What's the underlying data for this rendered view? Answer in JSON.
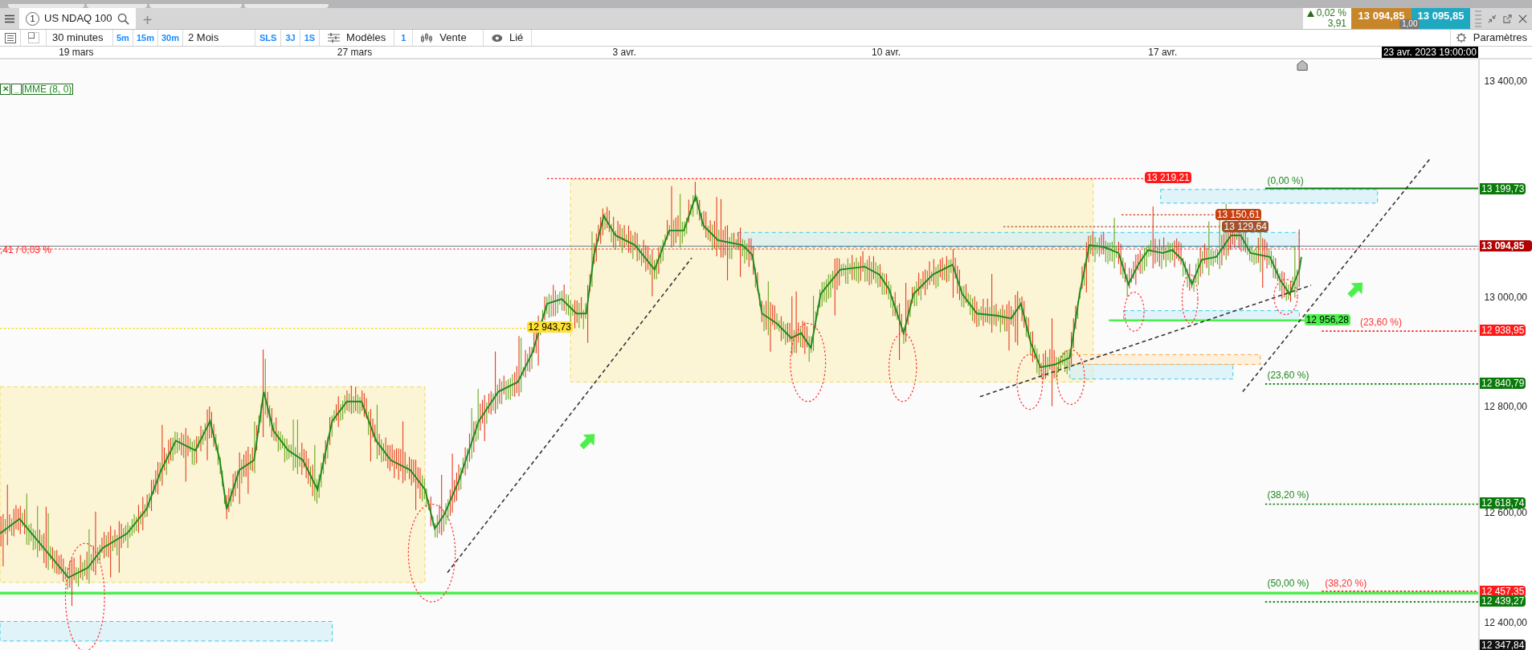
{
  "tabs": [
    {
      "number": "1",
      "label": "US NDAQ 100",
      "selected": true
    }
  ],
  "add_tab": "+",
  "quote": {
    "change": "0,02 %",
    "change_points": "3,91",
    "bid": "13 094,85",
    "ask": "13 095,85",
    "spread": "1,00"
  },
  "toolbar": {
    "interval": "30 minutes",
    "quick_intervals": [
      "5m",
      "15m",
      "30m"
    ],
    "range": "2 Mois",
    "range_buttons": [
      "SLS",
      "3J",
      "1S"
    ],
    "templates": "Modèles",
    "count": "1",
    "chart_type": "Vente",
    "linked": "Lié",
    "settings": "Paramètres"
  },
  "date_axis": {
    "labels": [
      "19 mars",
      "27 mars",
      "3 avr.",
      "10 avr.",
      "17 avr."
    ],
    "crosshair_time": "23 avr. 2023 19:00:00"
  },
  "legend": {
    "close": "✕",
    "minimize": "_",
    "indicator": "MME (8, 0)"
  },
  "price_axis": {
    "ticks": [
      "13 400,00",
      "13 000,00",
      "12 800,00",
      "12 600,00",
      "12 400,00"
    ],
    "tags": [
      {
        "text": "13 199,73",
        "color": "#0a7a0a"
      },
      {
        "text": "13 094,85",
        "color": "#b30000"
      },
      {
        "text": "12 938,95",
        "color": "#ff1a1a"
      },
      {
        "text": "12 840,79",
        "color": "#0a7a0a"
      },
      {
        "text": "12 618,74",
        "color": "#0a7a0a"
      },
      {
        "text": "12 457,35",
        "color": "#ff1a1a"
      },
      {
        "text": "12 439,27",
        "color": "#0a7a0a"
      },
      {
        "text": "12 347,84",
        "color": "#111111"
      }
    ]
  },
  "chart_labels": [
    {
      "text": "13 219,21",
      "color": "#ff1a1a"
    },
    {
      "text": "13 150,61",
      "color": "#c8400f"
    },
    {
      "text": "13 129,64",
      "color": "#a0522d"
    },
    {
      "text": "12 943,73",
      "color": "#ffe033"
    },
    {
      "text": "12 956,28",
      "color": "#4cf04c"
    }
  ],
  "fib_labels": [
    {
      "text": "(0,00 %)",
      "color": "#1f8a1f"
    },
    {
      "text": "(23,60 %)",
      "color": "#1f8a1f"
    },
    {
      "text": "(38,20 %)",
      "color": "#1f8a1f"
    },
    {
      "text": "(50,00 %)",
      "color": "#1f8a1f"
    },
    {
      "text": "(23,60 %)",
      "color": "#ff3333"
    },
    {
      "text": "(38,20 %)",
      "color": "#ff3333"
    }
  ],
  "left_label": ",41 / 0,03 %"
}
